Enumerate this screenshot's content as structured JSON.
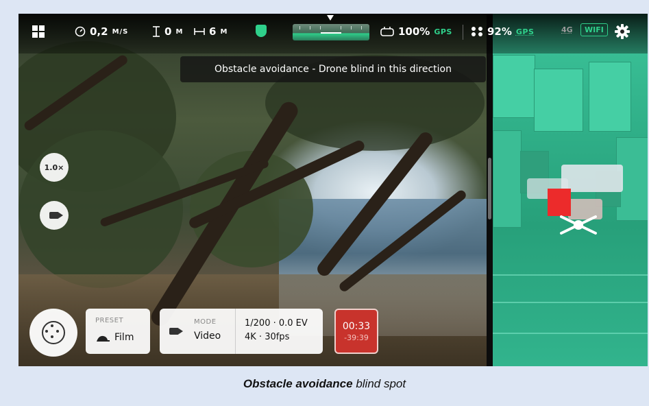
{
  "status_bar": {
    "speed_value": "0,2",
    "speed_unit": "M/S",
    "height_value": "0",
    "height_unit": "M",
    "distance_value": "6",
    "distance_unit": "M",
    "controller_battery": "100%",
    "controller_gps": "GPS",
    "drone_battery": "92%",
    "drone_gps": "GPS",
    "network_4g": "4G",
    "wifi_label": "WIFI"
  },
  "banner": {
    "text": "Obstacle avoidance - Drone blind in this direction"
  },
  "left_controls": {
    "zoom_label": "1.0×"
  },
  "bottom_bar": {
    "preset_caption": "PRESET",
    "preset_value": "Film",
    "mode_caption": "MODE",
    "mode_value": "Video",
    "exposure": "1/200 · 0.0 EV",
    "resolution": "4K · 30fps",
    "rec_elapsed": "00:33",
    "rec_remaining": "-39:39"
  },
  "caption": {
    "bold": "Obstacle avoidance",
    "rest": " blind spot"
  },
  "colors": {
    "accent": "#2fd08b",
    "record": "#c8332c",
    "obstacle": "#ec2b2b"
  }
}
